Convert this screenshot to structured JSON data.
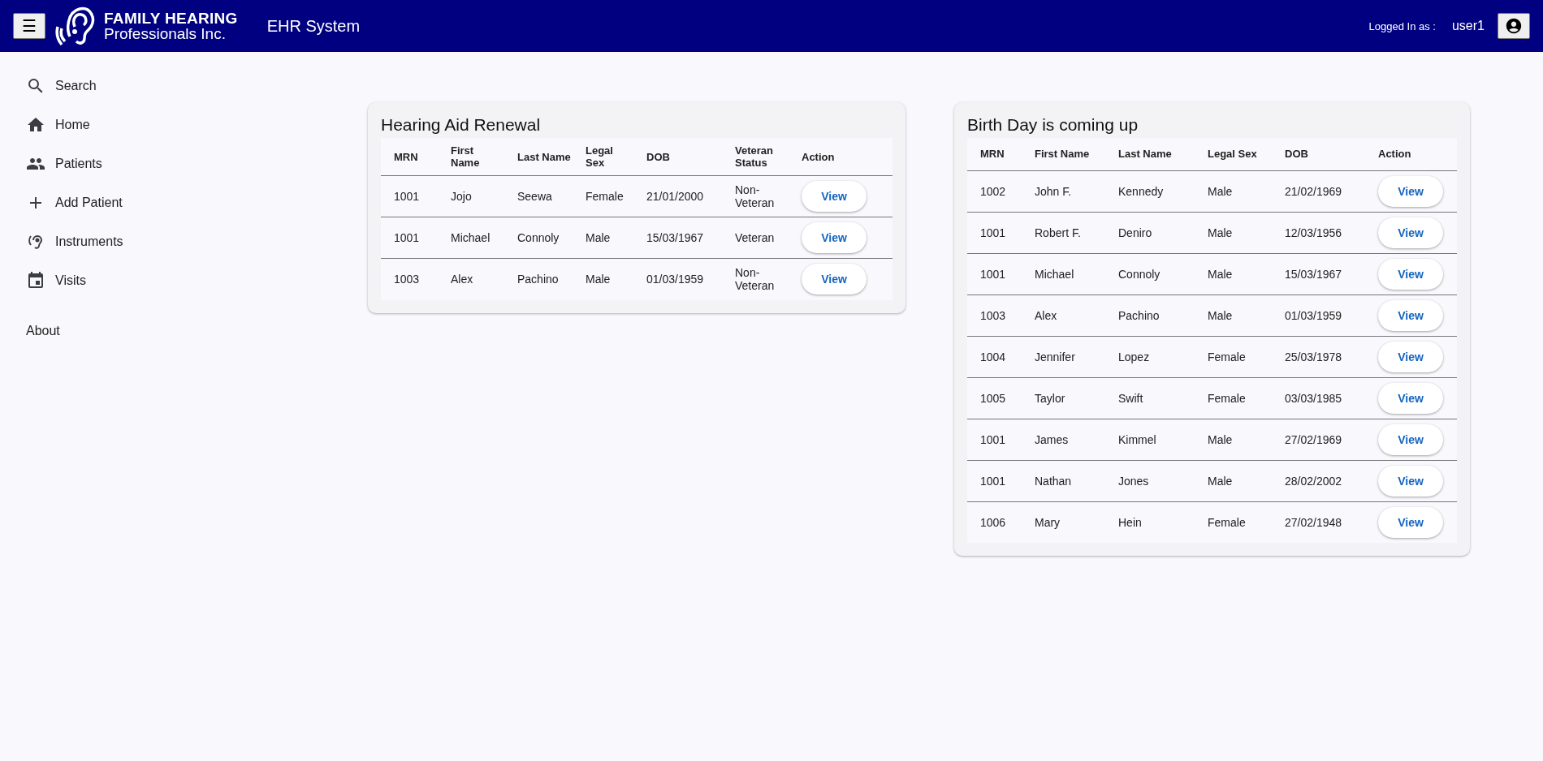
{
  "header": {
    "menu_button": "☰",
    "logo": {
      "line_1": "FAMILY HEARING",
      "line_2": "Professionals Inc."
    },
    "title": "EHR System",
    "logged_in_label": "Logged In as :",
    "username": "user1"
  },
  "sidebar": {
    "items": [
      {
        "label": "Search",
        "kind": "search"
      },
      {
        "label": "Home",
        "kind": "home"
      },
      {
        "label": "Patients",
        "kind": "people"
      },
      {
        "label": "Add Patient",
        "kind": "plus"
      },
      {
        "label": "Instruments",
        "kind": "ear"
      },
      {
        "label": "Visits",
        "kind": "calendar"
      }
    ],
    "about": "About"
  },
  "cards": [
    {
      "title": "Hearing Aid Renewal",
      "columns": [
        "MRN",
        "First Name",
        "Last Name",
        "Legal Sex",
        "DOB",
        "Veteran Status",
        "Action"
      ],
      "rows": [
        {
          "cells": [
            "1001",
            "Jojo",
            "Seewa",
            "Female",
            "21/01/2000",
            "Non-Veteran"
          ],
          "action": "View"
        },
        {
          "cells": [
            "1001",
            "Michael",
            "Connoly",
            "Male",
            "15/03/1967",
            "Veteran"
          ],
          "action": "View"
        },
        {
          "cells": [
            "1003",
            "Alex",
            "Pachino",
            "Male",
            "01/03/1959",
            "Non-Veteran"
          ],
          "action": "View"
        }
      ]
    },
    {
      "title": "Birth Day is coming up",
      "columns": [
        "MRN",
        "First Name",
        "Last Name",
        "Legal Sex",
        "DOB",
        "Action"
      ],
      "rows": [
        {
          "cells": [
            "1002",
            "John F.",
            "Kennedy",
            "Male",
            "21/02/1969"
          ],
          "action": "View"
        },
        {
          "cells": [
            "1001",
            "Robert F.",
            "Deniro",
            "Male",
            "12/03/1956"
          ],
          "action": "View"
        },
        {
          "cells": [
            "1001",
            "Michael",
            "Connoly",
            "Male",
            "15/03/1967"
          ],
          "action": "View"
        },
        {
          "cells": [
            "1003",
            "Alex",
            "Pachino",
            "Male",
            "01/03/1959"
          ],
          "action": "View"
        },
        {
          "cells": [
            "1004",
            "Jennifer",
            "Lopez",
            "Female",
            "25/03/1978"
          ],
          "action": "View"
        },
        {
          "cells": [
            "1005",
            "Taylor",
            "Swift",
            "Female",
            "03/03/1985"
          ],
          "action": "View"
        },
        {
          "cells": [
            "1001",
            "James",
            "Kimmel",
            "Male",
            "27/02/1969"
          ],
          "action": "View"
        },
        {
          "cells": [
            "1001",
            "Nathan",
            "Jones",
            "Male",
            "28/02/2002"
          ],
          "action": "View"
        },
        {
          "cells": [
            "1006",
            "Mary",
            "Hein",
            "Female",
            "27/02/1948"
          ],
          "action": "View"
        }
      ]
    }
  ]
}
